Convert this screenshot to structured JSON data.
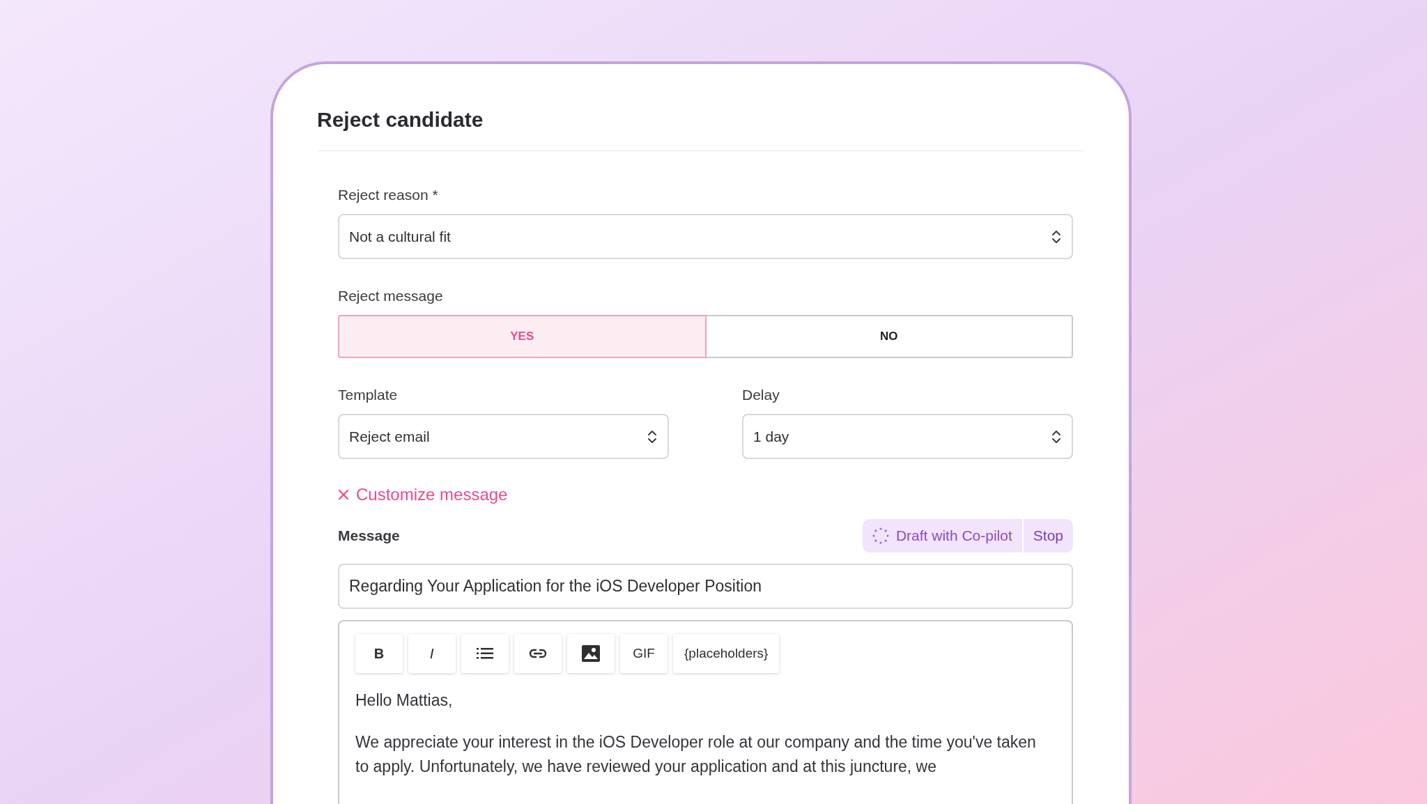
{
  "dialog": {
    "title": "Reject candidate"
  },
  "reject_reason": {
    "label": "Reject reason *",
    "value": "Not a cultural fit"
  },
  "reject_message": {
    "label": "Reject message",
    "options": [
      {
        "label": "YES",
        "selected": true
      },
      {
        "label": "NO",
        "selected": false
      }
    ]
  },
  "template": {
    "label": "Template",
    "value": "Reject email"
  },
  "delay": {
    "label": "Delay",
    "value": "1 day"
  },
  "customize": {
    "label": "Customize message"
  },
  "message": {
    "label": "Message",
    "draft_button": "Draft with Co-pilot",
    "stop_button": "Stop",
    "subject": "Regarding Your Application for the iOS Developer Position",
    "toolbar": [
      {
        "kind": "bold",
        "label": "B"
      },
      {
        "kind": "italic",
        "label": "I"
      },
      {
        "kind": "list"
      },
      {
        "kind": "link"
      },
      {
        "kind": "image"
      },
      {
        "kind": "text",
        "label": "GIF"
      },
      {
        "kind": "text",
        "label": "{placeholders}"
      }
    ],
    "body": [
      "Hello Mattias,",
      "We appreciate your interest in the iOS Developer role at our company and the time you've taken to apply. Unfortunately, we have reviewed your application and at this juncture, we"
    ]
  }
}
